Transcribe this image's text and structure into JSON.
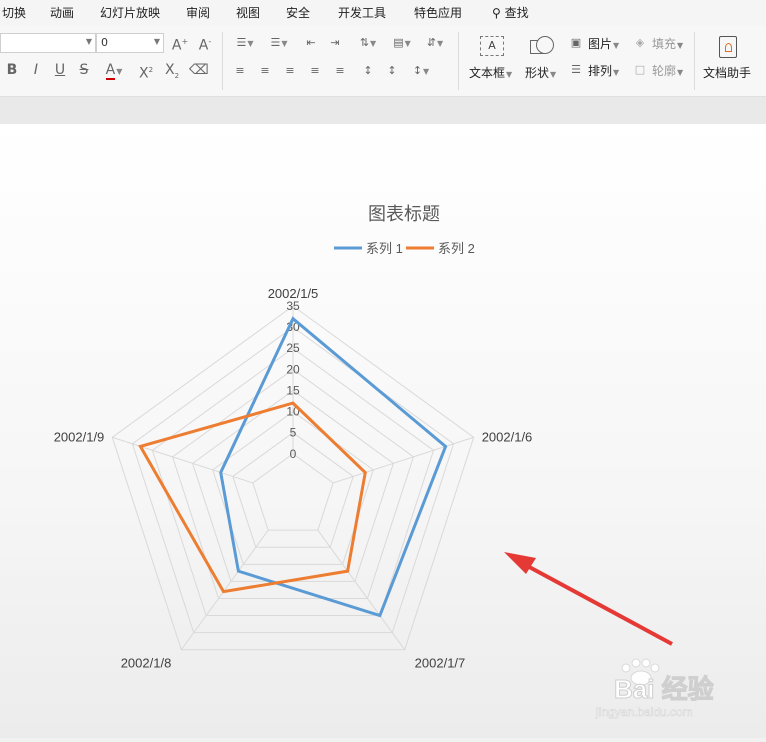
{
  "menu": [
    "切换",
    "动画",
    "幻灯片放映",
    "审阅",
    "视图",
    "安全",
    "开发工具",
    "特色应用",
    "查找"
  ],
  "ribbon": {
    "font_name": "",
    "font_size": "0",
    "buttons": {
      "textbox": "文本框",
      "shape": "形状",
      "picture": "图片",
      "arrange": "排列",
      "fill": "填充",
      "outline": "轮廓",
      "doc_helper": "文档助手"
    }
  },
  "chart_data": {
    "type": "radar",
    "title": "图表标题",
    "categories": [
      "2002/1/5",
      "2002/1/6",
      "2002/1/7",
      "2002/1/8",
      "2002/1/9"
    ],
    "series": [
      {
        "name": "系列 1",
        "color": "#5b9bd5",
        "values": [
          32,
          28,
          25,
          12,
          8
        ]
      },
      {
        "name": "系列 2",
        "color": "#ed7d31",
        "values": [
          12,
          8,
          12,
          18,
          28
        ]
      }
    ],
    "r_ticks": [
      0,
      5,
      10,
      15,
      20,
      25,
      30,
      35
    ],
    "rlim": [
      -10,
      35
    ],
    "legend": "top"
  },
  "watermark": {
    "logo": "Bai 经验",
    "url": "jingyan.baidu.com"
  },
  "annotation": {
    "color": "#e53935"
  }
}
